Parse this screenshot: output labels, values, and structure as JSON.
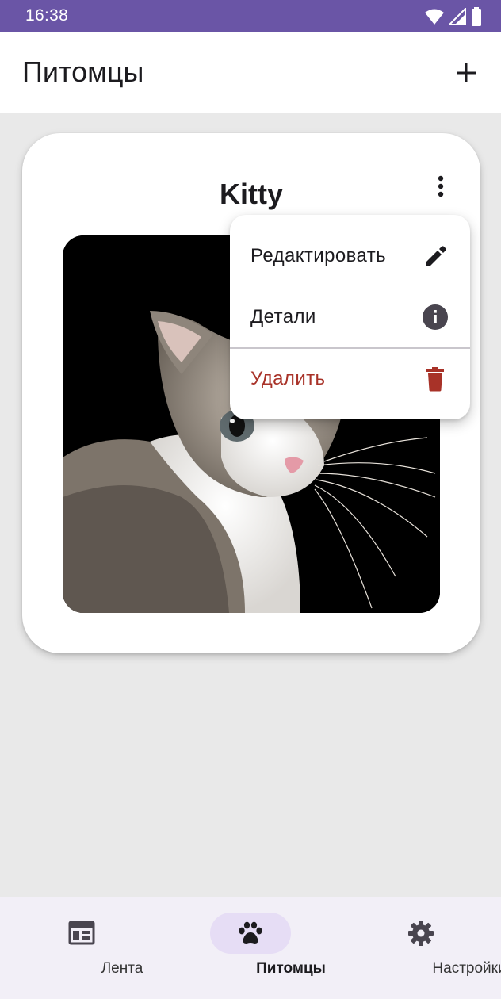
{
  "status_bar": {
    "time": "16:38",
    "icons": [
      "wifi-icon",
      "signal-icon",
      "battery-icon"
    ]
  },
  "app_bar": {
    "title": "Питомцы",
    "add_icon": "plus-icon"
  },
  "pet_card": {
    "name": "Kitty",
    "more_icon": "more-vert-icon",
    "photo": "cat-photo"
  },
  "menu": {
    "items": [
      {
        "label": "Редактировать",
        "icon": "pencil-icon"
      },
      {
        "label": "Детали",
        "icon": "info-icon"
      },
      {
        "label": "Удалить",
        "icon": "trash-icon"
      }
    ]
  },
  "bottom_nav": {
    "items": [
      {
        "label": "Лента",
        "icon": "feed-icon",
        "active": false
      },
      {
        "label": "Питомцы",
        "icon": "paw-icon",
        "active": true
      },
      {
        "label": "Настройки",
        "icon": "gear-icon",
        "active": false
      }
    ]
  },
  "colors": {
    "status_bar": "#6a55a6",
    "background": "#e9e9e9",
    "danger": "#a83228",
    "nav_active_pill": "#e6ddf5"
  }
}
